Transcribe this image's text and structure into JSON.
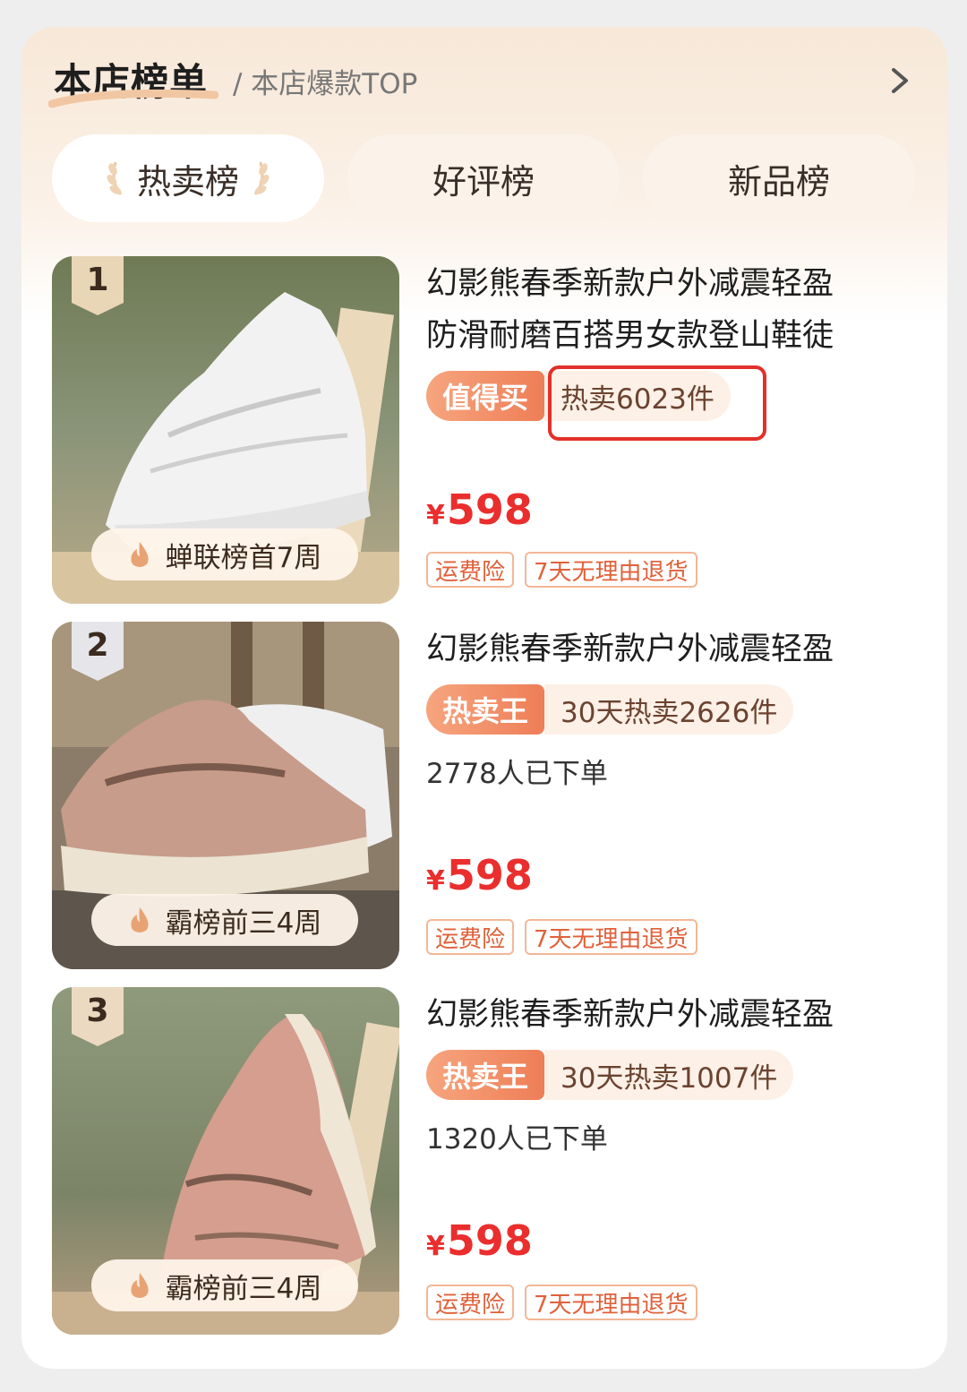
{
  "header": {
    "title": "本店榜单",
    "subtitle": "/ 本店爆款TOP"
  },
  "tabs": [
    {
      "label": "热卖榜",
      "active": true
    },
    {
      "label": "好评榜",
      "active": false
    },
    {
      "label": "新品榜",
      "active": false
    }
  ],
  "products": [
    {
      "rank": "1",
      "award": "蝉联榜首7周",
      "title_lines": [
        "幻影熊春季新款户外减震轻盈",
        "防滑耐磨百搭男女款登山鞋徒"
      ],
      "tag_main": "值得买",
      "tag_sub": "热卖6023件",
      "ordered": "",
      "price_symbol": "¥",
      "price": "598",
      "services": [
        "运费险",
        "7天无理由退货"
      ]
    },
    {
      "rank": "2",
      "award": "霸榜前三4周",
      "title_lines": [
        "幻影熊春季新款户外减震轻盈"
      ],
      "tag_main": "热卖王",
      "tag_sub": "30天热卖2626件",
      "ordered": "2778人已下单",
      "price_symbol": "¥",
      "price": "598",
      "services": [
        "运费险",
        "7天无理由退货"
      ]
    },
    {
      "rank": "3",
      "award": "霸榜前三4周",
      "title_lines": [
        "幻影熊春季新款户外减震轻盈"
      ],
      "tag_main": "热卖王",
      "tag_sub": "30天热卖1007件",
      "ordered": "1320人已下单",
      "price_symbol": "¥",
      "price": "598",
      "services": [
        "运费险",
        "7天无理由退货"
      ]
    }
  ],
  "colors": {
    "price": "#ea2e2e",
    "tag_gradient_start": "#f6a57e",
    "tag_gradient_end": "#ee7e57",
    "highlight_border": "#e2302a"
  }
}
